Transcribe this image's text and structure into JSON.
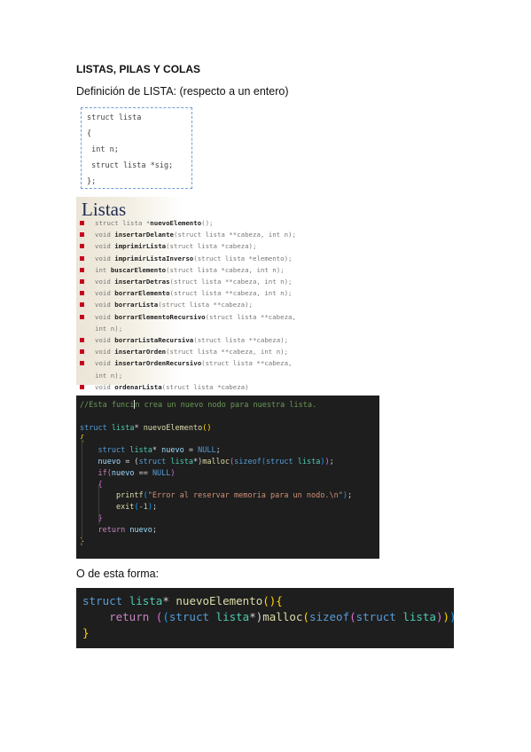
{
  "heading": "LISTAS, PILAS Y COLAS",
  "intro": "Definición de LISTA: (respecto a un entero)",
  "struct_def": [
    "struct lista",
    "{",
    " int n;",
    " struct lista *sig;",
    "};"
  ],
  "listas_title": "Listas",
  "prototypes": [
    {
      "pre": "struct lista *",
      "name": "nuevoElemento",
      "post": "();"
    },
    {
      "pre": "void ",
      "name": "insertarDelante",
      "post": "(struct lista **cabeza, int n);"
    },
    {
      "pre": "void ",
      "name": "imprimirLista",
      "post": "(struct lista *cabeza);"
    },
    {
      "pre": "void ",
      "name": "imprimirListaInverso",
      "post": "(struct lista *elemento);"
    },
    {
      "pre": "int ",
      "name": "buscarElemento",
      "post": "(struct lista *cabeza, int n);"
    },
    {
      "pre": "void ",
      "name": "insertarDetras",
      "post": "(struct lista **cabeza, int n);"
    },
    {
      "pre": "void ",
      "name": "borrarElemento",
      "post": "(struct lista **cabeza, int n);"
    },
    {
      "pre": "void ",
      "name": "borrarLista",
      "post": "(struct lista **cabeza);"
    },
    {
      "pre": "void ",
      "name": "borrarElementoRecursivo",
      "post": "(struct lista **cabeza,",
      "cont": "int n);"
    },
    {
      "pre": "void ",
      "name": "borrarListaRecursiva",
      "post": "(struct lista **cabeza);"
    },
    {
      "pre": "void ",
      "name": "insertarOrden",
      "post": "(struct lista **cabeza, int n);"
    },
    {
      "pre": "void ",
      "name": "insertarOrdenRecursivo",
      "post": "(struct lista **cabeza,",
      "cont": "int n);"
    },
    {
      "pre": "void ",
      "name": "ordenarLista",
      "post": "(struct lista *cabeza)"
    }
  ],
  "code1": {
    "comment_a": "//Esta funci",
    "comment_b": "n crea un nuevo nodo para nuestra lista.",
    "line2_struct": "struct",
    "line2_type": "lista",
    "line2_star": "* ",
    "line2_fn": "nuevoElemento",
    "line4": {
      "kw": "struct",
      "ty": "lista",
      "star": "* ",
      "var": "nuevo",
      "eq": " = ",
      "null": "NULL",
      "end": ";"
    },
    "line5": {
      "var": "nuevo",
      "eq": " = (",
      "kw": "struct",
      "ty": "lista",
      "cast": "*)",
      "fn": "malloc",
      "kw2": "sizeof",
      "kw3": "struct",
      "ty2": "lista",
      "end": ");"
    },
    "line6": {
      "ctl": "if",
      "var": "nuevo",
      "op": " == ",
      "null": "NULL"
    },
    "line8": {
      "fn": "printf",
      "str": "\"Error al reservar memoria para un nodo.\\n\"",
      "end": ");"
    },
    "line9": {
      "fn": "exit",
      "num": "-1",
      "end": ");"
    },
    "line11": {
      "ctl": "return",
      "var": "nuevo",
      "end": ";"
    }
  },
  "para2": "O de esta forma:",
  "code2": {
    "kw": "struct",
    "ty": "lista",
    "star": "* ",
    "fn": "nuevoElemento",
    "ret": "return",
    "kw2": "struct",
    "ty2": "lista",
    "cast": "*)",
    "malloc": "malloc",
    "sizeof": "sizeof",
    "kw3": "struct",
    "ty3": "lista",
    "end": ";"
  }
}
